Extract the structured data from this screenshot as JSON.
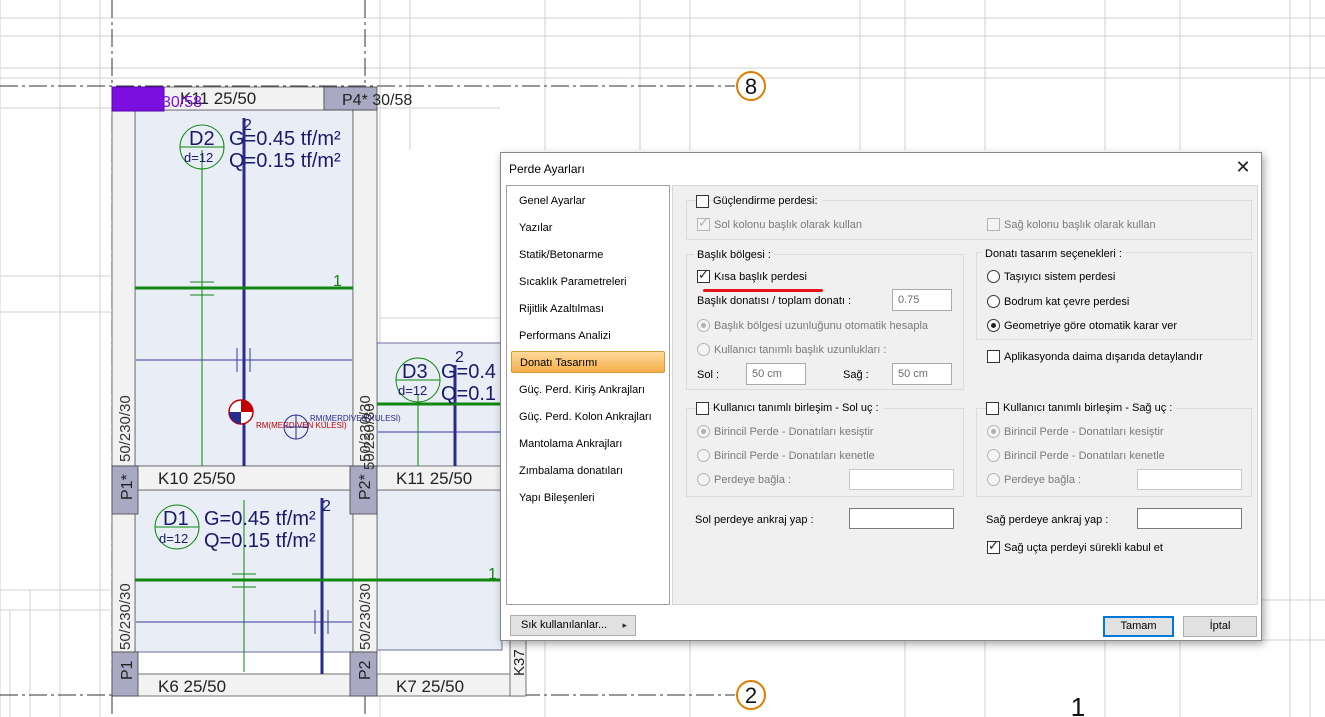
{
  "drawing": {
    "axes": [
      {
        "label": "8"
      },
      {
        "label": "2"
      }
    ],
    "corner_mark": "1",
    "columns": [
      {
        "label": "P4* 30/58"
      },
      {
        "label": "30/58"
      },
      {
        "label": "P1*"
      },
      {
        "label": "P2*"
      },
      {
        "label": "P1"
      },
      {
        "label": "P2"
      }
    ],
    "beams": [
      {
        "label": "K11 25/50"
      },
      {
        "label": "K10 25/50"
      },
      {
        "label": "K11 25/50"
      },
      {
        "label": "K6 25/50"
      },
      {
        "label": "K7 25/50"
      },
      {
        "label": "K37"
      }
    ],
    "slabs": [
      {
        "name": "D2",
        "thickness": "d=12",
        "g": "G=0.45 tf/m²",
        "q": "Q=0.15 tf/m²",
        "span_mark": "2",
        "dir_mark": "1"
      },
      {
        "name": "D1",
        "thickness": "d=12",
        "g": "G=0.45 tf/m²",
        "q": "Q=0.15 tf/m²",
        "span_mark": "2",
        "dir_mark": "1"
      },
      {
        "name": "D3",
        "thickness": "d=12",
        "g": "G=0.4",
        "q": "Q=0.1",
        "span_mark": "2"
      }
    ],
    "wall_labels": [
      "50/230/30",
      "50/230/30",
      "50/230/30",
      "50/230/30",
      "50/230/30"
    ],
    "stair_labels": [
      "RM(MERDİVEN KULESİ)",
      "RM(MERDİVEN KULESİ)"
    ]
  },
  "dialog": {
    "title": "Perde Ayarları",
    "close_glyph": "✕",
    "nav": [
      {
        "label": "Genel Ayarlar",
        "active": false
      },
      {
        "label": "Yazılar",
        "active": false
      },
      {
        "label": "Statik/Betonarme",
        "active": false
      },
      {
        "label": "Sıcaklık Parametreleri",
        "active": false
      },
      {
        "label": "Rijitlik Azaltılması",
        "active": false
      },
      {
        "label": "Performans Analizi",
        "active": false
      },
      {
        "label": "Donatı Tasarımı",
        "active": true
      },
      {
        "label": "Güç. Perd. Kiriş Ankrajları",
        "active": false
      },
      {
        "label": "Güç. Perd. Kolon Ankrajları",
        "active": false
      },
      {
        "label": "Mantolama Ankrajları",
        "active": false
      },
      {
        "label": "Zımbalama donatıları",
        "active": false
      },
      {
        "label": "Yapı Bileşenleri",
        "active": false
      }
    ],
    "strengthening": {
      "label": "Güçlendirme perdesi:",
      "checked": false,
      "left_col_head": {
        "label": "Sol kolonu başlık olarak kullan",
        "checked": true
      },
      "right_col_head": {
        "label": "Sağ kolonu başlık olarak kullan",
        "checked": false
      }
    },
    "head_region": {
      "title": "Başlık bölgesi :",
      "short_head": {
        "label": "Kısa başlık perdesi",
        "checked": true
      },
      "ratio_label": "Başlık donatısı / toplam donatı :",
      "ratio_value": "0.75",
      "auto_length": "Başlık bölgesi uzunluğunu otomatik hesapla",
      "user_length": "Kullanıcı tanımlı başlık uzunlukları :",
      "left_label": "Sol :",
      "left_value": "50 cm",
      "right_label": "Sağ :",
      "right_value": "50 cm"
    },
    "design_options": {
      "title": "Donatı tasarım seçenekleri :",
      "opt1": "Taşıyıcı sistem perdesi",
      "opt2": "Bodrum kat çevre perdesi",
      "opt3": "Geometriye göre otomatik karar ver",
      "selected": 3
    },
    "outside_detail": {
      "label": "Aplikasyonda daima dışarıda detaylandır",
      "checked": false
    },
    "left_joint": {
      "label": "Kullanıcı tanımlı birleşim - Sol uç :",
      "checked": false,
      "opt1": "Birincil Perde - Donatıları kesiştir",
      "opt2": "Birincil Perde - Donatıları kenetle",
      "opt3": "Perdeye bağla :"
    },
    "right_joint": {
      "label": "Kullanıcı tanımlı birleşim - Sağ uç :",
      "checked": false,
      "opt1": "Birincil Perde - Donatıları kesiştir",
      "opt2": "Birincil Perde - Donatıları kenetle",
      "opt3": "Perdeye bağla :"
    },
    "left_anchor": "Sol perdeye ankraj yap :",
    "right_anchor": "Sağ perdeye ankraj yap :",
    "right_continuous": {
      "label": "Sağ uçta perdeyi sürekli kabul et",
      "checked": true
    },
    "favorites_label": "Sık kullanılanlar...",
    "favorites_arrow": "▸",
    "ok_label": "Tamam",
    "cancel_label": "İptal"
  }
}
